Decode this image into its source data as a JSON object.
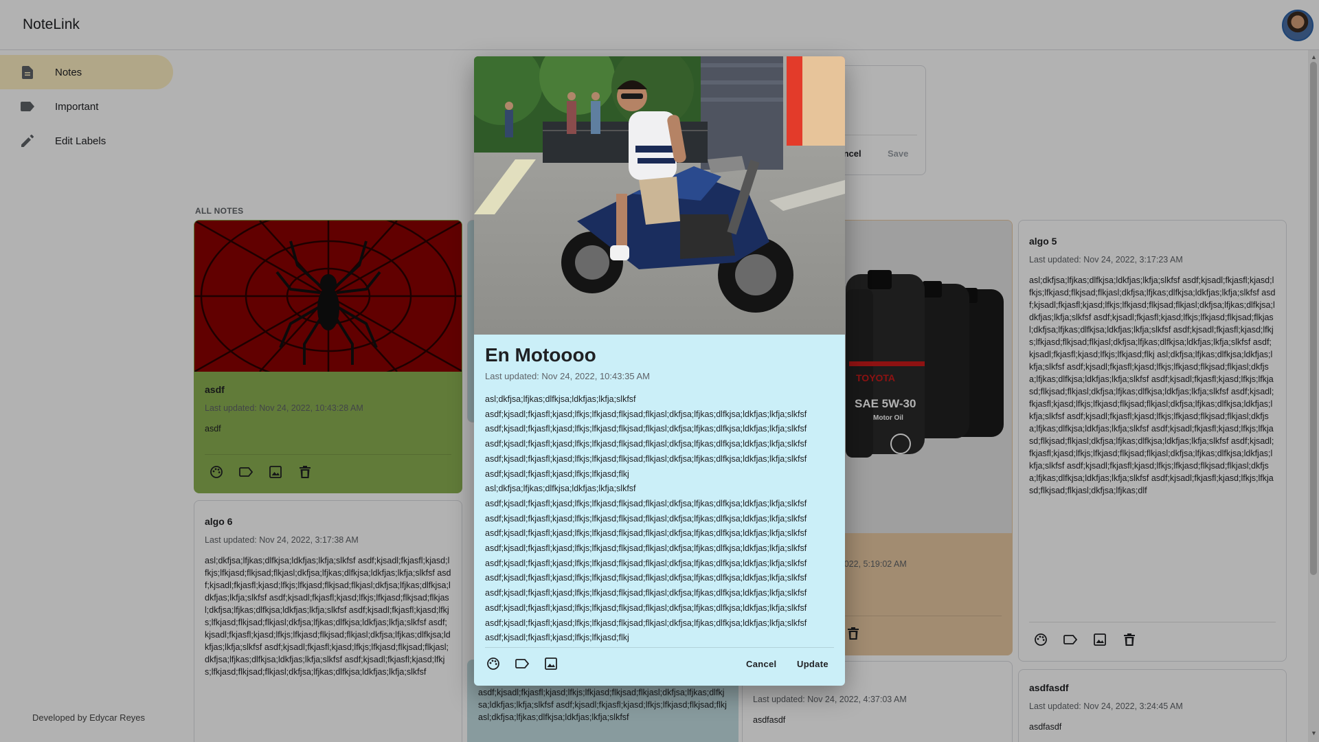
{
  "app": {
    "title": "NoteLink"
  },
  "sidebar": {
    "items": [
      {
        "label": "Notes",
        "icon": "document-icon",
        "active": true
      },
      {
        "label": "Important",
        "icon": "label-icon",
        "active": false
      },
      {
        "label": "Edit Labels",
        "icon": "pencil-icon",
        "active": false
      }
    ],
    "footer": "Developed by Edycar Reyes"
  },
  "create_note": {
    "cancel_label": "Cancel",
    "save_label": "Save"
  },
  "section_label": "ALL NOTES",
  "notes": [
    {
      "title": "asdf",
      "updated": "Last updated: Nov 24, 2022, 10:43:28 AM",
      "text": "asdf",
      "color": "#8bb052",
      "image": "spider-web"
    },
    {
      "title": "algo 6",
      "updated": "Last updated: Nov 24, 2022, 3:17:38 AM",
      "text": "asl;dkfjsa;lfjkas;dlfkjsa;ldkfjas;lkfja;slkfsf asdf;kjsadl;fkjasfl;kjasd;lfkjs;lfkjasd;flkjsad;flkjasl;dkfjsa;lfjkas;dlfkjsa;ldkfjas;lkfja;slkfsf asdf;kjsadl;fkjasfl;kjasd;lfkjs;lfkjasd;flkjsad;flkjasl;dkfjsa;lfjkas;dlfkjsa;ldkfjas;lkfja;slkfsf asdf;kjsadl;fkjasfl;kjasd;lfkjs;lfkjasd;flkjsad;flkjasl;dkfjsa;lfjkas;dlfkjsa;ldkfjas;lkfja;slkfsf asdf;kjsadl;fkjasfl;kjasd;lfkjs;lfkjasd;flkjsad;flkjasl;dkfjsa;lfjkas;dlfkjsa;ldkfjas;lkfja;slkfsf asdf;kjsadl;fkjasfl;kjasd;lfkjs;lfkjasd;flkjsad;flkjasl;dkfjsa;lfjkas;dlfkjsa;ldkfjas;lkfja;slkfsf asdf;kjsadl;fkjasfl;kjasd;lfkjs;lfkjasd;flkjsad;flkjasl;dkfjsa;lfjkas;dlfkjsa;ldkfjas;lkfja;slkfsf asdf;kjsadl;fkjasfl;kjasd;lfkjs;lfkjasd;flkjsad;flkjasl;dkfjsa;lfjkas;dlfkjsa;ldkfjas;lkfja;slkfsf"
    },
    {
      "title": "",
      "updated": "Last updated: Nov 24, 2022, 4:37:03 AM",
      "text": "asdfasdf"
    },
    {
      "title": "",
      "updated": "Last updated: Nov 24, 2022, 5:19:02 AM",
      "text": "",
      "image": "oil-bottles",
      "bottle_labels": {
        "brand": "TOYOTA",
        "grade": "SAE 5W-30",
        "type": "Motor Oil"
      }
    },
    {
      "title": "algo 5",
      "updated": "Last updated: Nov 24, 2022, 3:17:23 AM",
      "text": "asl;dkfjsa;lfjkas;dlfkjsa;ldkfjas;lkfja;slkfsf asdf;kjsadl;fkjasfl;kjasd;lfkjs;lfkjasd;flkjsad;flkjasl;dkfjsa;lfjkas;dlfkjsa;ldkfjas;lkfja;slkfsf asdf;kjsadl;fkjasfl;kjasd;lfkjs;lfkjasd;flkjsad;flkjasl;dkfjsa;lfjkas;dlfkjsa;ldkfjas;lkfja;slkfsf asdf;kjsadl;fkjasfl;kjasd;lfkjs;lfkjasd;flkjsad;flkjasl;dkfjsa;lfjkas;dlfkjsa;ldkfjas;lkfja;slkfsf asdf;kjsadl;fkjasfl;kjasd;lfkjs;lfkjasd;flkjsad;flkjasl;dkfjsa;lfjkas;dlfkjsa;ldkfjas;lkfja;slkfsf asdf;kjsadl;fkjasfl;kjasd;lfkjs;lfkjasd;flkj asl;dkfjsa;lfjkas;dlfkjsa;ldkfjas;lkfja;slkfsf asdf;kjsadl;fkjasfl;kjasd;lfkjs;lfkjasd;flkjsad;flkjasl;dkfjsa;lfjkas;dlfkjsa;ldkfjas;lkfja;slkfsf asdf;kjsadl;fkjasfl;kjasd;lfkjs;lfkjasd;flkjsad;flkjasl;dkfjsa;lfjkas;dlfkjsa;ldkfjas;lkfja;slkfsf asdf;kjsadl;fkjasfl;kjasd;lfkjs;lfkjasd;flkjsad;flkjasl;dkfjsa;lfjkas;dlfkjsa;ldkfjas;lkfja;slkfsf asdf;kjsadl;fkjasfl;kjasd;lfkjs;lfkjasd;flkjsad;flkjasl;dkfjsa;lfjkas;dlfkjsa;ldkfjas;lkfja;slkfsf asdf;kjsadl;fkjasfl;kjasd;lfkjs;lfkjasd;flkjsad;flkjasl;dkfjsa;lfjkas;dlfkjsa;ldkfjas;lkfja;slkfsf asdf;kjsadl;fkjasfl;kjasd;lfkjs;lfkjasd;flkjsad;flkjasl;dkfjsa;lfjkas;dlfkjsa;ldkfjas;lkfja;slkfsf asdf;kjsadl;fkjasfl;kjasd;lfkjs;lfkjasd;flkjsad;flkjasl;dkfjsa;lfjkas;dlfkjsa;ldkfjas;lkfja;slkfsf asdf;kjsadl;fkjasfl;kjasd;lfkjs;lfkjasd;flkjsad;flkjasl;dkfjsa;lfjkas;dlf"
    },
    {
      "title": "asdfasdf",
      "updated": "Last updated: Nov 24, 2022, 3:24:45 AM",
      "text": "asdfasdf"
    },
    {
      "title": "",
      "updated": "",
      "text": "asdf;kjsadl;fkjasfl;kjasd;lfkjs;lfkjasd;flkjsad;flkjasl;dkfjsa;lfjkas;dlfkjsa;ldkfjas;lkfja;slkfsf asdf;kjsadl;fkjasfl;kjasd;lfkjs;lfkjasd;flkjsad;flkjasl;dkfjsa;lfjkas;dlfkjsa;ldkfjas;lkfja;slkfsf"
    }
  ],
  "modal": {
    "title": "En Motoooo",
    "updated": "Last updated: Nov 24, 2022, 10:43:35 AM",
    "lines": [
      "asl;dkfjsa;lfjkas;dlfkjsa;ldkfjas;lkfja;slkfsf",
      "asdf;kjsadl;fkjasfl;kjasd;lfkjs;lfkjasd;flkjsad;flkjasl;dkfjsa;lfjkas;dlfkjsa;ldkfjas;lkfja;slkfsf",
      "asdf;kjsadl;fkjasfl;kjasd;lfkjs;lfkjasd;flkjsad;flkjasl;dkfjsa;lfjkas;dlfkjsa;ldkfjas;lkfja;slkfsf",
      "asdf;kjsadl;fkjasfl;kjasd;lfkjs;lfkjasd;flkjsad;flkjasl;dkfjsa;lfjkas;dlfkjsa;ldkfjas;lkfja;slkfsf",
      "asdf;kjsadl;fkjasfl;kjasd;lfkjs;lfkjasd;flkjsad;flkjasl;dkfjsa;lfjkas;dlfkjsa;ldkfjas;lkfja;slkfsf",
      "asdf;kjsadl;fkjasfl;kjasd;lfkjs;lfkjasd;flkj",
      "asl;dkfjsa;lfjkas;dlfkjsa;ldkfjas;lkfja;slkfsf",
      "asdf;kjsadl;fkjasfl;kjasd;lfkjs;lfkjasd;flkjsad;flkjasl;dkfjsa;lfjkas;dlfkjsa;ldkfjas;lkfja;slkfsf",
      "asdf;kjsadl;fkjasfl;kjasd;lfkjs;lfkjasd;flkjsad;flkjasl;dkfjsa;lfjkas;dlfkjsa;ldkfjas;lkfja;slkfsf",
      "asdf;kjsadl;fkjasfl;kjasd;lfkjs;lfkjasd;flkjsad;flkjasl;dkfjsa;lfjkas;dlfkjsa;ldkfjas;lkfja;slkfsf",
      "asdf;kjsadl;fkjasfl;kjasd;lfkjs;lfkjasd;flkjsad;flkjasl;dkfjsa;lfjkas;dlfkjsa;ldkfjas;lkfja;slkfsf",
      "asdf;kjsadl;fkjasfl;kjasd;lfkjs;lfkjasd;flkjsad;flkjasl;dkfjsa;lfjkas;dlfkjsa;ldkfjas;lkfja;slkfsf",
      "asdf;kjsadl;fkjasfl;kjasd;lfkjs;lfkjasd;flkjsad;flkjasl;dkfjsa;lfjkas;dlfkjsa;ldkfjas;lkfja;slkfsf",
      "asdf;kjsadl;fkjasfl;kjasd;lfkjs;lfkjasd;flkjsad;flkjasl;dkfjsa;lfjkas;dlfkjsa;ldkfjas;lkfja;slkfsf",
      "asdf;kjsadl;fkjasfl;kjasd;lfkjs;lfkjasd;flkjsad;flkjasl;dkfjsa;lfjkas;dlfkjsa;ldkfjas;lkfja;slkfsf",
      "asdf;kjsadl;fkjasfl;kjasd;lfkjs;lfkjasd;flkjsad;flkjasl;dkfjsa;lfjkas;dlfkjsa;ldkfjas;lkfja;slkfsf",
      "asdf;kjsadl;fkjasfl;kjasd;lfkjs;lfkjasd;flkj"
    ],
    "cancel_label": "Cancel",
    "update_label": "Update",
    "background": "#cbeff8"
  },
  "colors": {
    "active_nav": "#feefc3",
    "note_green": "#8bb052",
    "note_tan": "#e9c9a2",
    "note_teal": "#c3dfe2"
  }
}
